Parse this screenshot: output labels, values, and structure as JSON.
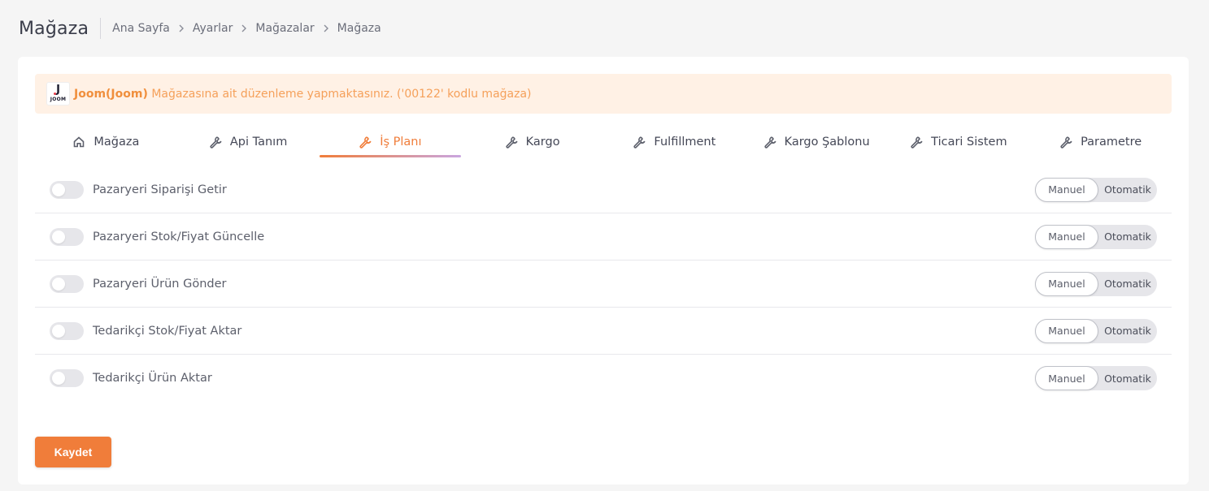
{
  "header": {
    "title": "Mağaza",
    "breadcrumb": [
      "Ana Sayfa",
      "Ayarlar",
      "Mağazalar",
      "Mağaza"
    ]
  },
  "notice": {
    "logo_text": "JOOM",
    "logo_letter": "J",
    "store_name": "Joom(Joom)",
    "message": " Mağazasına ait düzenleme yapmaktasınız. ('00122' kodlu mağaza)"
  },
  "tabs": [
    {
      "label": "Mağaza",
      "icon": "home-icon",
      "active": false
    },
    {
      "label": "Api Tanım",
      "icon": "wrench-icon",
      "active": false
    },
    {
      "label": "İş Planı",
      "icon": "wrench-icon",
      "active": true
    },
    {
      "label": "Kargo",
      "icon": "wrench-icon",
      "active": false
    },
    {
      "label": "Fulfillment",
      "icon": "wrench-icon",
      "active": false
    },
    {
      "label": "Kargo Şablonu",
      "icon": "wrench-icon",
      "active": false
    },
    {
      "label": "Ticari Sistem",
      "icon": "wrench-icon",
      "active": false
    },
    {
      "label": "Parametre",
      "icon": "wrench-icon",
      "active": false
    }
  ],
  "rows": [
    {
      "label": "Pazaryeri Siparişi Getir",
      "enabled": false,
      "mode_manual": "Manuel",
      "mode_auto": "Otomatik"
    },
    {
      "label": "Pazaryeri Stok/Fiyat Güncelle",
      "enabled": false,
      "mode_manual": "Manuel",
      "mode_auto": "Otomatik"
    },
    {
      "label": "Pazaryeri Ürün Gönder",
      "enabled": false,
      "mode_manual": "Manuel",
      "mode_auto": "Otomatik"
    },
    {
      "label": "Tedarikçi Stok/Fiyat Aktar",
      "enabled": false,
      "mode_manual": "Manuel",
      "mode_auto": "Otomatik"
    },
    {
      "label": "Tedarikçi Ürün Aktar",
      "enabled": false,
      "mode_manual": "Manuel",
      "mode_auto": "Otomatik"
    }
  ],
  "actions": {
    "save_label": "Kaydet"
  },
  "colors": {
    "accent": "#f07d3a",
    "notice_bg": "#fff1e5",
    "notice_text": "#f5a05a"
  }
}
